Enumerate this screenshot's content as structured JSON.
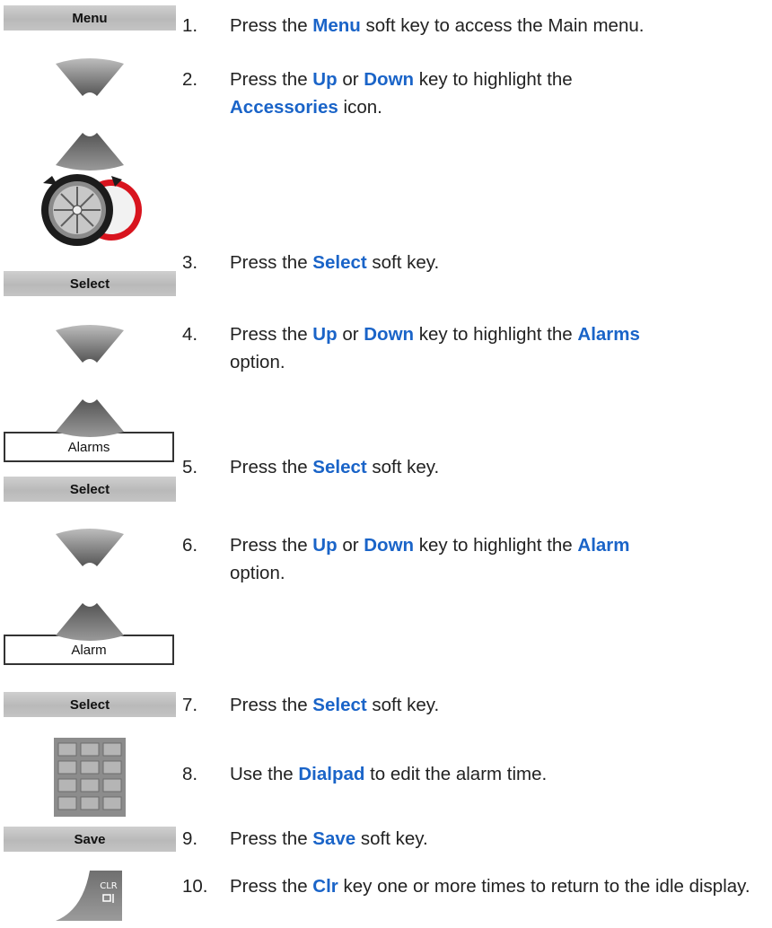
{
  "keys": {
    "menu": "Menu",
    "select1": "Select",
    "alarms_field": "Alarms",
    "select2": "Select",
    "alarm_field": "Alarm",
    "select3": "Select",
    "save": "Save"
  },
  "steps": [
    {
      "num": "1.",
      "parts": [
        "Press the ",
        "Menu",
        " soft key to access the Main menu."
      ]
    },
    {
      "num": "2.",
      "parts": [
        "Press the ",
        "Up",
        " or ",
        "Down",
        " key to highlight the ",
        "Accessories",
        " icon."
      ]
    },
    {
      "num": "3.",
      "parts": [
        "Press the ",
        "Select",
        " soft key."
      ]
    },
    {
      "num": "4.",
      "parts": [
        "Press the ",
        "Up",
        " or ",
        "Down",
        " key to highlight the ",
        "Alarms",
        " option."
      ]
    },
    {
      "num": "5.",
      "parts": [
        "Press the ",
        "Select",
        " soft key."
      ]
    },
    {
      "num": "6.",
      "parts": [
        "Press the ",
        "Up",
        " or ",
        "Down",
        " key to highlight the ",
        "Alarm",
        " option."
      ]
    },
    {
      "num": "7.",
      "parts": [
        "Press the ",
        "Select",
        " soft key."
      ]
    },
    {
      "num": "8.",
      "parts": [
        "Use the ",
        "Dialpad",
        " to edit the alarm time."
      ]
    },
    {
      "num": "9.",
      "parts": [
        "Press the ",
        "Save",
        " soft key."
      ]
    },
    {
      "num": "10.",
      "parts": [
        "Press the ",
        "Clr",
        " key one or more times to return to the idle display."
      ]
    }
  ],
  "clr_key": {
    "top": "CLR"
  },
  "colors": {
    "highlight": "#1a64c8",
    "softkey": "#c4c4c4"
  }
}
